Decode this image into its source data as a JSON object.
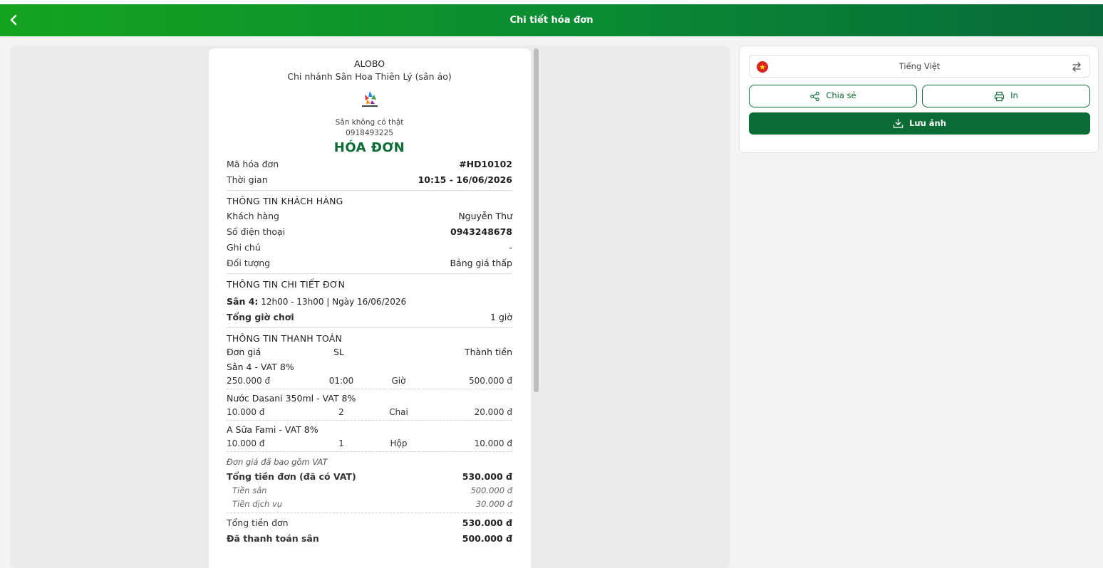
{
  "header": {
    "title": "Chi tiết hóa đơn"
  },
  "receipt": {
    "shop_name": "ALOBO",
    "branch": "Chi nhánh Sân Hoa Thiên Lý (sân ảo)",
    "address": "Sân không có thật",
    "phone": "0918493225",
    "title": "HÓA ĐƠN",
    "invoice_code_label": "Mã hóa đơn",
    "invoice_code": "#HD10102",
    "time_label": "Thời gian",
    "time": "10:15 - 16/06/2026",
    "customer_section": "THÔNG TIN KHÁCH HÀNG",
    "customer_label": "Khách hàng",
    "customer": "Nguyễn Thư",
    "customer_phone_label": "Số điện thoại",
    "customer_phone": "0943248678",
    "note_label": "Ghi chú",
    "note": "-",
    "object_label": "Đối tượng",
    "object": "Bảng giá thấp",
    "detail_section": "THÔNG TIN CHI TIẾT ĐƠN",
    "court_name": "Sân 4:",
    "court_time": " 12h00 - 13h00 | Ngày 16/06/2026",
    "total_hours_label": "Tổng giờ chơi",
    "total_hours": "1 giờ",
    "payment_section": "THÔNG TIN THANH TOÁN",
    "col_price": "Đơn giá",
    "col_qty": "SL",
    "col_total": "Thành tiền",
    "items": [
      {
        "name": "Sân 4 - VAT 8%",
        "price": "250.000 đ",
        "qty": "01:00",
        "unit": "Giờ",
        "total": "500.000 đ"
      },
      {
        "name": "Nước Dasani 350ml - VAT 8%",
        "price": "10.000 đ",
        "qty": "2",
        "unit": "Chai",
        "total": "20.000 đ"
      },
      {
        "name": "A Sữa Fami - VAT 8%",
        "price": "10.000 đ",
        "qty": "1",
        "unit": "Hộp",
        "total": "10.000 đ"
      }
    ],
    "vat_note": "Đơn giá đã bao gồm VAT",
    "order_total_vat_label": "Tổng tiền đơn (đã có VAT)",
    "order_total_vat": "530.000 đ",
    "court_fee_label": "Tiền sân",
    "court_fee": "500.000 đ",
    "service_fee_label": "Tiền dịch vụ",
    "service_fee": "30.000 đ",
    "order_total_label": "Tổng tiền đơn",
    "order_total": "530.000 đ",
    "paid_court_label": "Đã thanh toán sân",
    "paid_court": "500.000 đ"
  },
  "side": {
    "language": "Tiếng Việt",
    "share_label": "Chia sẻ",
    "print_label": "In",
    "save_label": "Lưu ảnh"
  },
  "colors": {
    "primary": "#0b6b35",
    "header_start": "#14a41f",
    "header_end": "#076a3a"
  }
}
